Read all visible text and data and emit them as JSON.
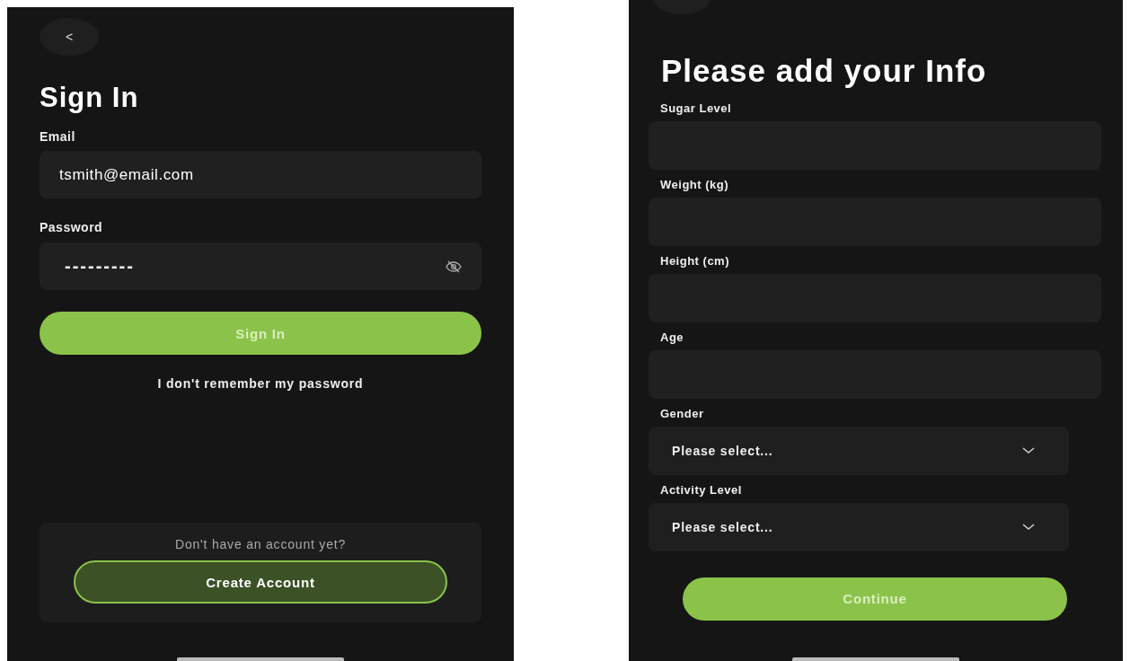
{
  "sign_in": {
    "back_button": "<",
    "title": "Sign In",
    "fields": [
      {
        "label": "Email",
        "value": "tsmith@email.com",
        "kind": "text"
      },
      {
        "label": "Password",
        "value": "---------",
        "kind": "password"
      }
    ],
    "primary_button": "Sign In",
    "forgot_link": "I don't remember my password",
    "signup_card": {
      "prompt": "Don't have an account yet?",
      "button": "Create Account"
    }
  },
  "info_form": {
    "title": "Please add your Info",
    "fields": [
      {
        "label": "Sugar Level",
        "kind": "input"
      },
      {
        "label": "Weight (kg)",
        "kind": "input"
      },
      {
        "label": "Height (cm)",
        "kind": "input"
      },
      {
        "label": "Age",
        "kind": "input"
      },
      {
        "label": "Gender",
        "kind": "select",
        "placeholder": "Please select..."
      },
      {
        "label": "Activity Level",
        "kind": "select",
        "placeholder": "Please select..."
      }
    ],
    "button": "Continue"
  }
}
